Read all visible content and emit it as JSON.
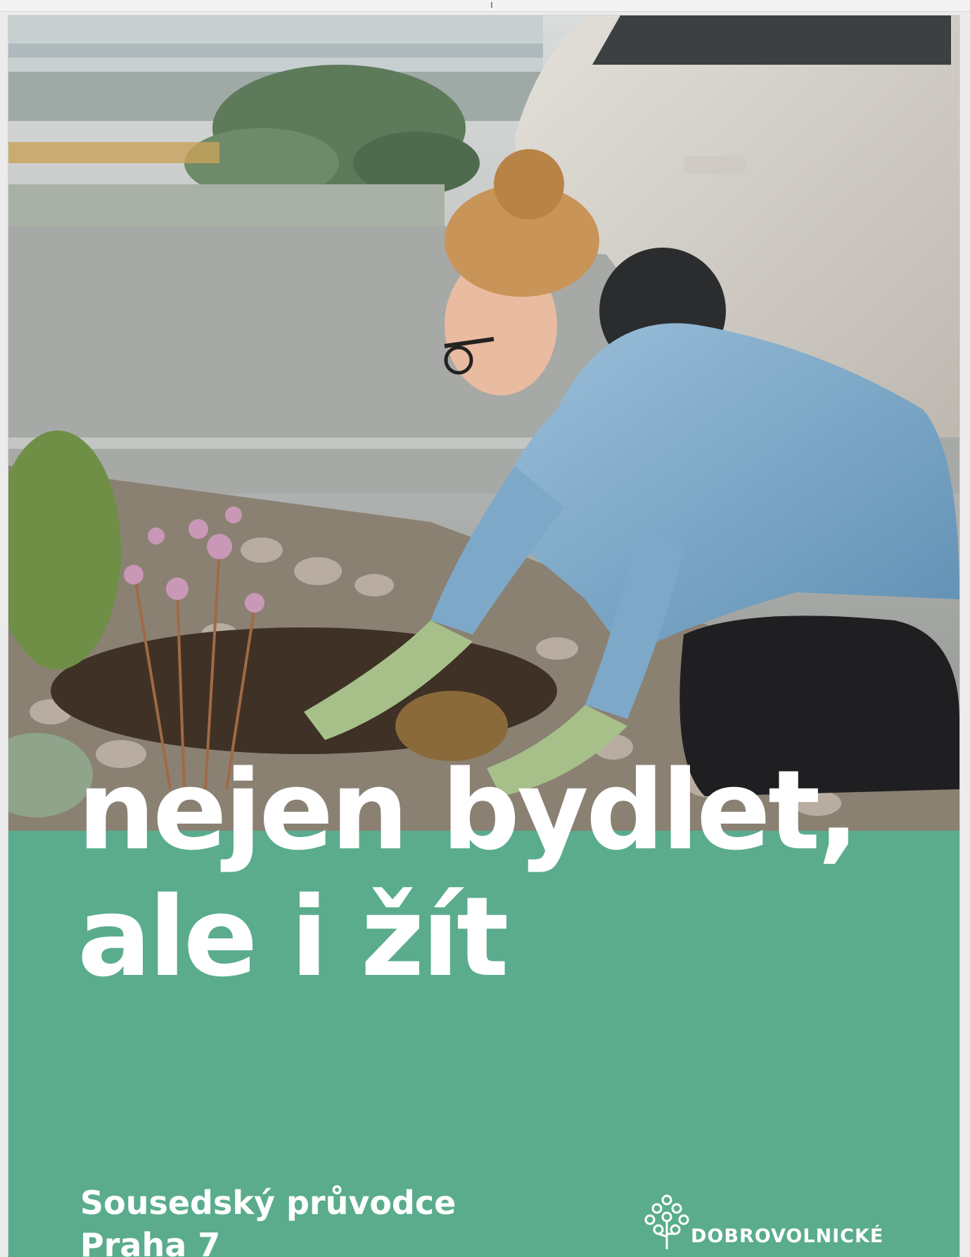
{
  "cover": {
    "headline": [
      "nejen bydlet,",
      "ale i žít"
    ],
    "subtitle": [
      "Sousedský průvodce",
      "Praha 7"
    ],
    "organization": "DOBROVOLNICKÉ",
    "colors": {
      "panel": "#5aac8d",
      "text": "#ffffff"
    }
  }
}
